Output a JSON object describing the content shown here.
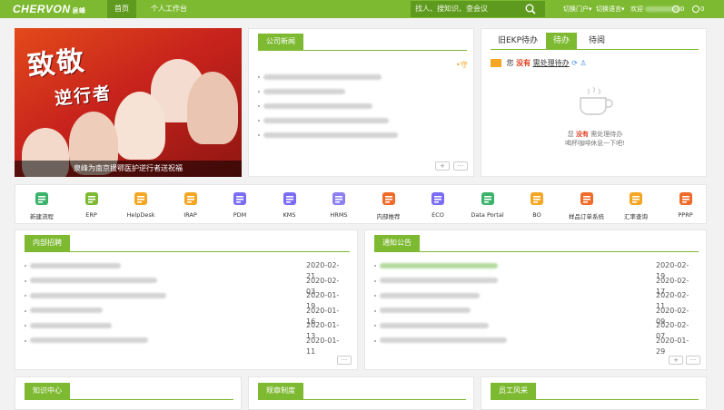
{
  "topbar": {
    "logo": "CHERVON",
    "logo_sub": "泉峰",
    "nav": [
      "首页",
      "个人工作台"
    ],
    "search_placeholder": "找人、搜知识、查会议",
    "switch_portal": "切换门户",
    "switch_language": "切换语言",
    "welcome": "欢迎",
    "count_a": "0",
    "count_b": "0"
  },
  "banner": {
    "title_line1": "致敬",
    "title_line2": "逆行者",
    "caption": "泉峰为南京援鄂医护逆行者送祝福"
  },
  "company_news": {
    "title": "公司新闻",
    "more_label": "+",
    "more_dots": "···"
  },
  "ekp": {
    "tabs": [
      "旧EKP待办",
      "待办",
      "待阅"
    ],
    "active_tab": 1,
    "status_prefix": "您",
    "status_none": "没有",
    "status_suffix": "需处理待办",
    "empty_line1_a": "您",
    "empty_line1_b": "没有",
    "empty_line1_c": "需处理待办",
    "empty_line2": "喝杯咖啡休息一下吧!"
  },
  "apps": [
    {
      "label": "新建流程",
      "icon": "new-process-icon",
      "color": "#3bb36b"
    },
    {
      "label": "ERP",
      "icon": "erp-icon",
      "color": "#7dba31"
    },
    {
      "label": "HelpDesk",
      "icon": "helpdesk-icon",
      "color": "#f5a623"
    },
    {
      "label": "IRAP",
      "icon": "irap-icon",
      "color": "#f5a623"
    },
    {
      "label": "PDM",
      "icon": "pdm-icon",
      "color": "#7b6cf6"
    },
    {
      "label": "KMS",
      "icon": "kms-icon",
      "color": "#7b6cf6"
    },
    {
      "label": "HRMS",
      "icon": "hrms-icon",
      "color": "#8c7ff0"
    },
    {
      "label": "内部推荐",
      "icon": "referral-icon",
      "color": "#f06a2a"
    },
    {
      "label": "ECO",
      "icon": "eco-icon",
      "color": "#7b6cf6"
    },
    {
      "label": "Data Portal",
      "icon": "data-portal-icon",
      "color": "#3bb36b"
    },
    {
      "label": "BO",
      "icon": "bo-icon",
      "color": "#f5a623"
    },
    {
      "label": "样品订单系统",
      "icon": "sample-order-icon",
      "color": "#f06a2a"
    },
    {
      "label": "汇率查询",
      "icon": "exchange-rate-icon",
      "color": "#f5a623"
    },
    {
      "label": "PPRP",
      "icon": "pprp-icon",
      "color": "#f06a2a"
    }
  ],
  "internal_recruit": {
    "title": "内部招聘",
    "dates": [
      "2020-02-21",
      "2020-02-03",
      "2020-01-19",
      "2020-01-16",
      "2020-01-13",
      "2020-01-11"
    ],
    "more_dots": "···"
  },
  "notices": {
    "title": "通知公告",
    "dates": [
      "2020-02-19",
      "2020-02-17",
      "2020-02-11",
      "2020-02-09",
      "2020-02-07",
      "2020-01-29"
    ],
    "more_label": "+",
    "more_dots": "···"
  },
  "bottom_sections": [
    "知识中心",
    "规章制度",
    "员工风采"
  ],
  "colors": {
    "brand": "#7dba31",
    "brand_dark": "#5e9a1d",
    "alert": "#e23b1d"
  }
}
